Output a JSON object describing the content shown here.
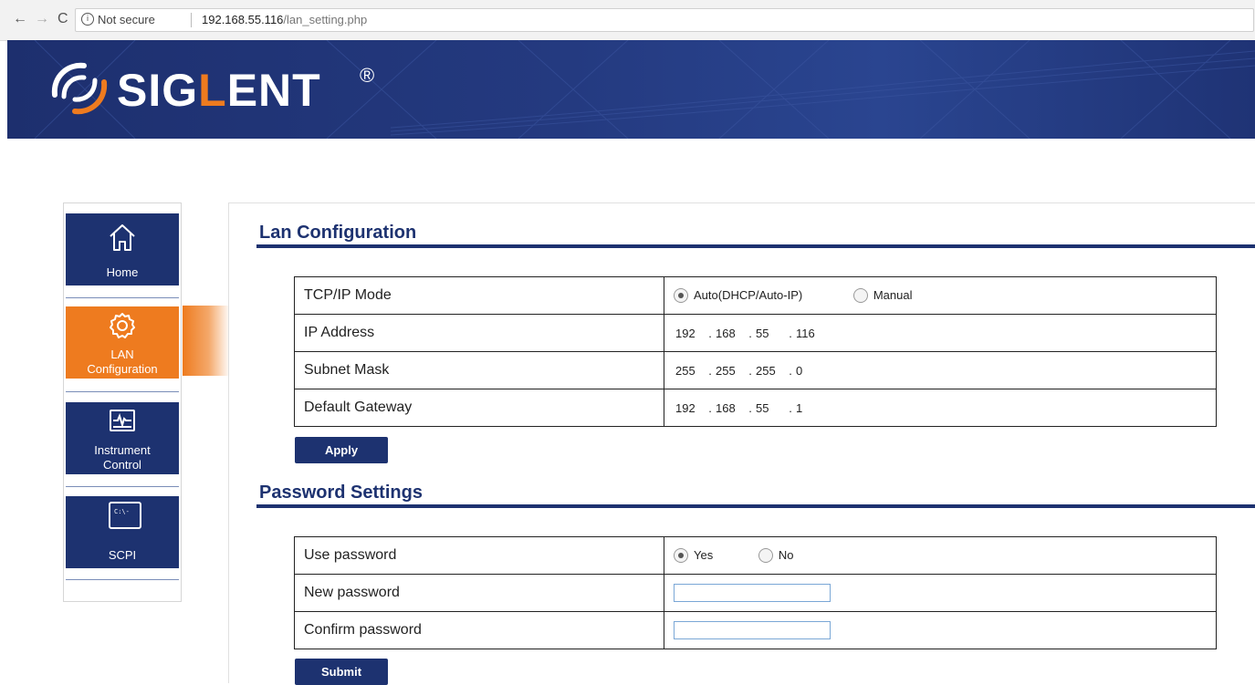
{
  "browser": {
    "back_icon": "←",
    "forward_icon": "→",
    "reload_icon": "C",
    "info_icon": "i",
    "security_text": "Not secure",
    "url_host": "192.168.55.116",
    "url_path": "/lan_setting.php"
  },
  "brand": {
    "name_pre": "SIG",
    "name_accent": "L",
    "name_post": "ENT",
    "reg": "®"
  },
  "sidebar": {
    "items": [
      {
        "label": "Home",
        "icon": "home-icon"
      },
      {
        "label_line1": "LAN",
        "label_line2": "Configuration",
        "icon": "gear-icon",
        "active": true
      },
      {
        "label_line1": "Instrument",
        "label_line2": "Control",
        "icon": "monitor-pulse-icon"
      },
      {
        "label": "SCPI",
        "icon": "terminal-icon",
        "icon_text": "C:\\-"
      }
    ]
  },
  "lan": {
    "title": "Lan Configuration",
    "mode_label": "TCP/IP Mode",
    "mode_auto": "Auto(DHCP/Auto-IP)",
    "mode_manual": "Manual",
    "mode_selected": "auto",
    "ip_label": "IP Address",
    "ip": [
      "192",
      "168",
      "55",
      "116"
    ],
    "mask_label": "Subnet Mask",
    "mask": [
      "255",
      "255",
      "255",
      "0"
    ],
    "gw_label": "Default Gateway",
    "gw": [
      "192",
      "168",
      "55",
      "1"
    ],
    "apply_label": "Apply"
  },
  "password": {
    "title": "Password Settings",
    "use_label": "Use password",
    "use_yes": "Yes",
    "use_no": "No",
    "use_selected": "yes",
    "new_label": "New password",
    "new_value": "",
    "confirm_label": "Confirm password",
    "confirm_value": "",
    "submit_label": "Submit"
  },
  "colors": {
    "navy": "#1d3270",
    "orange": "#ee7b1f"
  }
}
